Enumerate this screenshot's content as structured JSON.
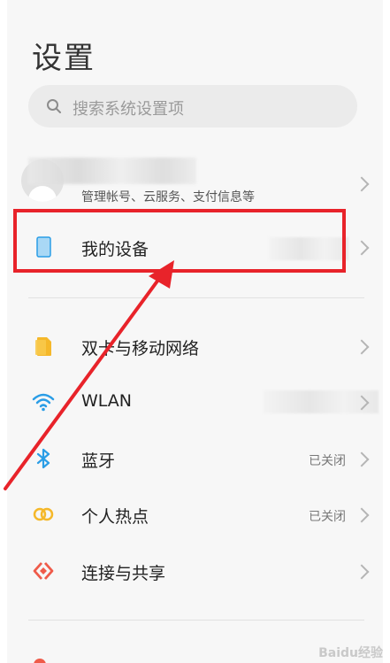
{
  "header": {
    "title": "设置"
  },
  "search": {
    "placeholder": "搜索系统设置项"
  },
  "account": {
    "subtitle": "管理帐号、云服务、支付信息等"
  },
  "rows": [
    {
      "label": "我的设备",
      "status": "",
      "icon": "phone-icon"
    },
    {
      "label": "双卡与移动网络",
      "status": "",
      "icon": "sim-card-icon"
    },
    {
      "label": "WLAN",
      "status": "",
      "icon": "wifi-icon"
    },
    {
      "label": "蓝牙",
      "status": "已关闭",
      "icon": "bluetooth-icon"
    },
    {
      "label": "个人热点",
      "status": "已关闭",
      "icon": "hotspot-icon"
    },
    {
      "label": "连接与共享",
      "status": "",
      "icon": "share-icon"
    }
  ],
  "colors": {
    "annotation_red": "#e8232a",
    "wifi_blue": "#2a9de6",
    "sim_yellow": "#f5b82a",
    "share_red": "#ef5b4a"
  },
  "watermark": {
    "text": "Baidu经验"
  }
}
